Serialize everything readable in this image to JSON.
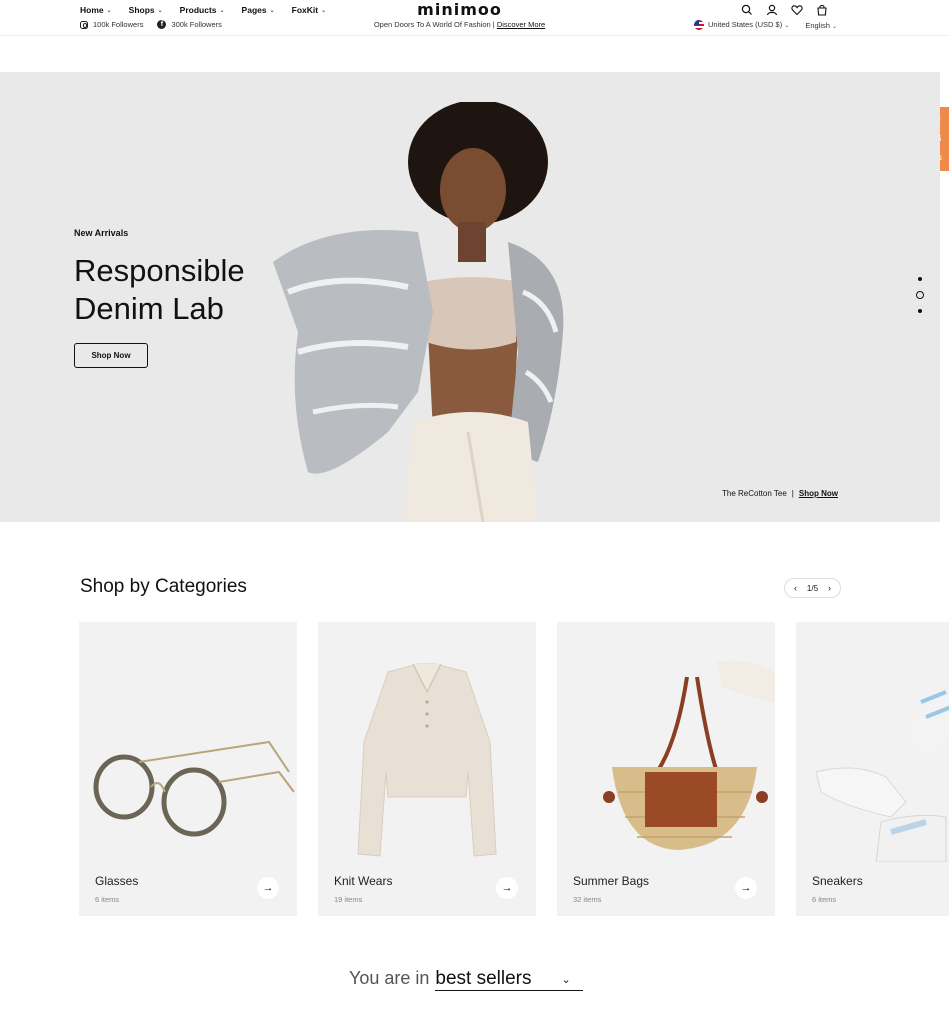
{
  "header": {
    "logo": "minimoo",
    "nav": [
      {
        "label": "Home"
      },
      {
        "label": "Shops"
      },
      {
        "label": "Products"
      },
      {
        "label": "Pages"
      },
      {
        "label": "FoxKit"
      }
    ],
    "social": [
      {
        "icon": "instagram-icon",
        "label": "100k Followers"
      },
      {
        "icon": "facebook-icon",
        "label": "300k Followers"
      }
    ],
    "tagline": "Open Doors To A World Of Fashion |",
    "tagline_link": "Discover More",
    "currency": "United States (USD $)",
    "language": "English",
    "icons": [
      "search-icon",
      "account-icon",
      "wishlist-icon",
      "cart-icon"
    ]
  },
  "hero": {
    "eyebrow": "New Arrivals",
    "title": "Responsible Denim Lab",
    "button": "Shop Now",
    "product_name": "The ReCotton Tee",
    "product_sep": "|",
    "product_link": "Shop Now",
    "slides_total": 3,
    "slide_active": 2
  },
  "categories": {
    "title": "Shop by Categories",
    "pager": "1/5",
    "items": [
      {
        "name": "Glasses",
        "count": "6 items"
      },
      {
        "name": "Knit Wears",
        "count": "19 items"
      },
      {
        "name": "Summer Bags",
        "count": "32 items"
      },
      {
        "name": "Sneakers",
        "count": "6 items"
      }
    ]
  },
  "bestsellers": {
    "prefix": "You are in",
    "selected": "best sellers"
  },
  "colors": {
    "accent": "#f08a4b",
    "hero_bg": "#e9e9e9",
    "card_bg": "#f2f2f2"
  }
}
